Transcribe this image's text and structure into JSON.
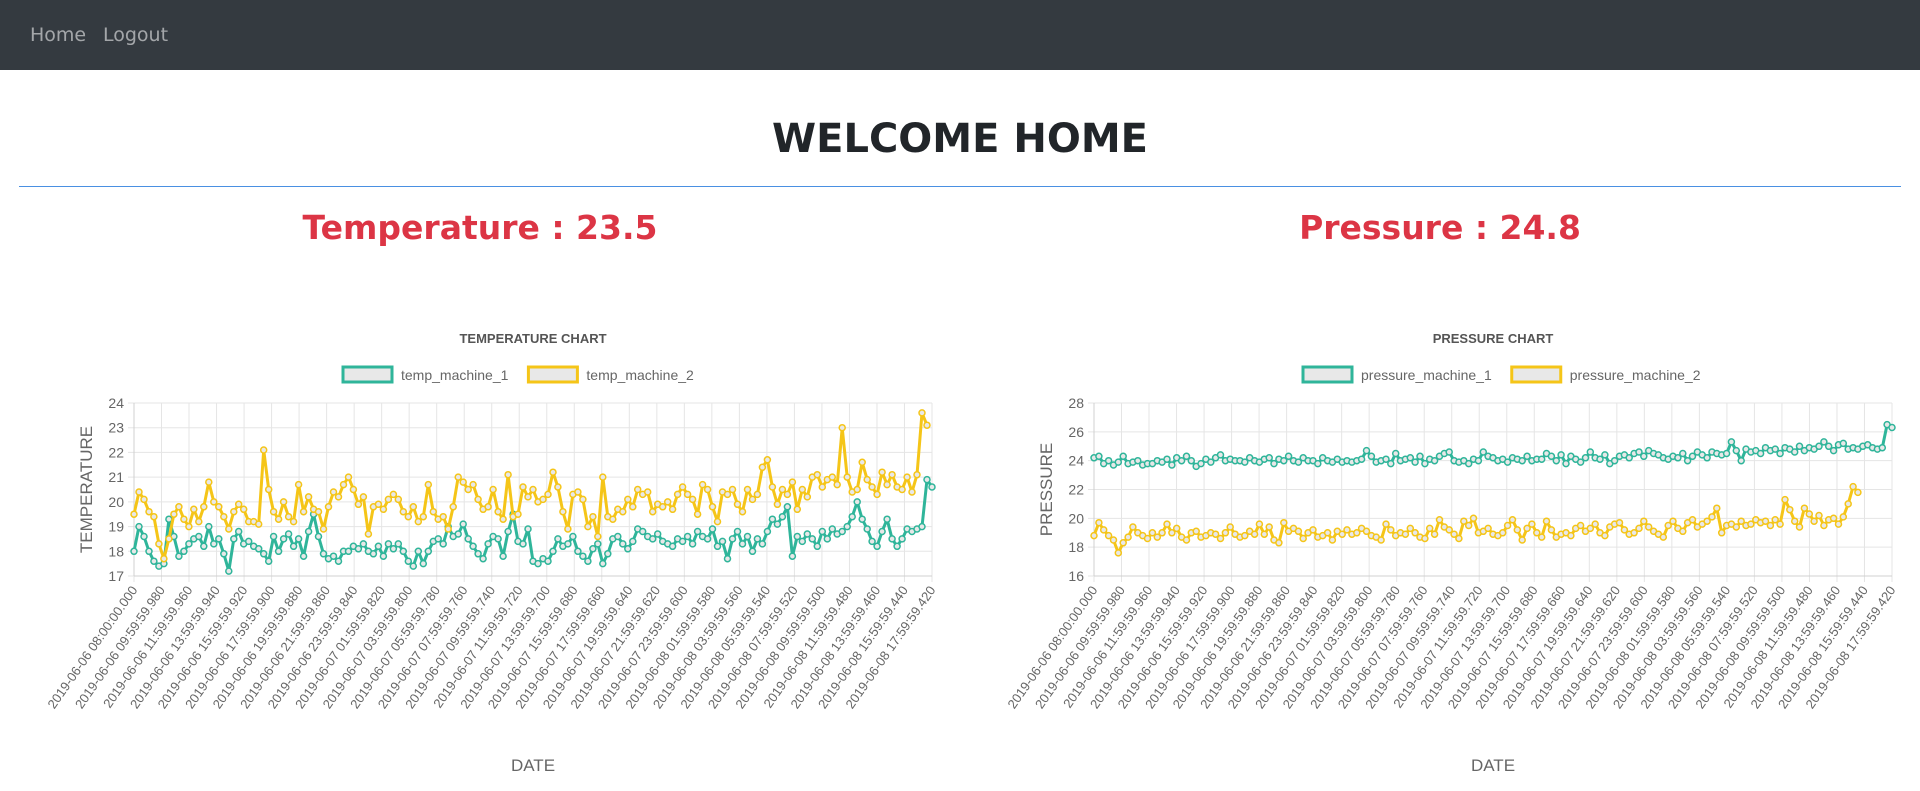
{
  "nav": {
    "home_label": "Home",
    "logout_label": "Logout"
  },
  "page": {
    "title": "WELCOME HOME",
    "temperature_reading": "Temperature : 23.5",
    "pressure_reading": "Pressure : 24.8"
  },
  "colors": {
    "navbar": "#343a40",
    "accent_red": "#dc3545",
    "divider_blue": "#4a90e2",
    "series_teal": "#2fb59a",
    "series_yellow": "#f5c518"
  },
  "chart_data": [
    {
      "type": "line",
      "title": "TEMPERATURE CHART",
      "xlabel": "DATE",
      "ylabel": "TEMPERATURE",
      "ylim": [
        17,
        24
      ],
      "yticks": [
        17,
        18,
        19,
        20,
        21,
        22,
        23,
        24
      ],
      "grid": true,
      "legend_position": "top",
      "tick_labels": [
        "2019-06-06 08:00:00.000",
        "2019-06-06 09:59:59.980",
        "2019-06-06 11:59:59.960",
        "2019-06-06 13:59:59.940",
        "2019-06-06 15:59:59.920",
        "2019-06-06 17:59:59.900",
        "2019-06-06 19:59:59.880",
        "2019-06-06 21:59:59.860",
        "2019-06-06 23:59:59.840",
        "2019-06-07 01:59:59.820",
        "2019-06-07 03:59:59.800",
        "2019-06-07 05:59:59.780",
        "2019-06-07 07:59:59.760",
        "2019-06-07 09:59:59.740",
        "2019-06-07 11:59:59.720",
        "2019-06-07 13:59:59.700",
        "2019-06-07 15:59:59.680",
        "2019-06-07 17:59:59.660",
        "2019-06-07 19:59:59.640",
        "2019-06-07 21:59:59.620",
        "2019-06-07 23:59:59.600",
        "2019-06-08 01:59:59.580",
        "2019-06-08 03:59:59.560",
        "2019-06-08 05:59:59.540",
        "2019-06-08 07:59:59.520",
        "2019-06-08 09:59:59.500",
        "2019-06-08 11:59:59.480",
        "2019-06-08 13:59:59.460",
        "2019-06-08 15:59:59.440",
        "2019-06-08 17:59:59.420"
      ],
      "series": [
        {
          "name": "temp_machine_1",
          "color": "#2fb59a",
          "values": [
            18.0,
            19.0,
            18.6,
            18.0,
            17.6,
            17.4,
            17.5,
            19.3,
            18.6,
            17.8,
            18.0,
            18.3,
            18.5,
            18.6,
            18.2,
            19.0,
            18.3,
            18.5,
            17.9,
            17.2,
            18.5,
            18.8,
            18.3,
            18.4,
            18.2,
            18.1,
            17.9,
            17.6,
            18.6,
            18.0,
            18.5,
            18.7,
            18.2,
            18.5,
            17.8,
            18.8,
            19.5,
            18.6,
            17.9,
            17.7,
            17.8,
            17.6,
            18.0,
            18.0,
            18.2,
            18.1,
            18.3,
            18.0,
            17.9,
            18.2,
            17.8,
            18.3,
            18.1,
            18.3,
            18.0,
            17.6,
            17.4,
            18.0,
            17.5,
            18.0,
            18.4,
            18.5,
            18.3,
            19.0,
            18.6,
            18.7,
            19.1,
            18.5,
            18.2,
            17.9,
            17.7,
            18.3,
            18.6,
            18.5,
            17.8,
            18.8,
            19.5,
            18.4,
            18.3,
            18.9,
            17.6,
            17.5,
            17.7,
            17.6,
            18.0,
            18.5,
            18.2,
            18.3,
            18.6,
            18.0,
            17.8,
            17.6,
            18.1,
            18.3,
            17.5,
            17.9,
            18.5,
            18.6,
            18.3,
            18.1,
            18.4,
            18.9,
            18.8,
            18.6,
            18.5,
            18.7,
            18.4,
            18.3,
            18.2,
            18.5,
            18.4,
            18.6,
            18.3,
            18.8,
            18.6,
            18.5,
            18.9,
            18.2,
            18.4,
            17.7,
            18.5,
            18.8,
            18.3,
            18.6,
            18.0,
            18.5,
            18.3,
            18.8,
            19.3,
            19.1,
            19.4,
            19.8,
            17.8,
            18.6,
            18.4,
            18.7,
            18.5,
            18.2,
            18.8,
            18.5,
            18.9,
            18.7,
            18.8,
            19.0,
            19.4,
            20.0,
            19.3,
            18.9,
            18.4,
            18.2,
            18.8,
            19.3,
            18.5,
            18.2,
            18.5,
            18.9,
            18.8,
            18.9,
            19.0,
            20.9,
            20.6
          ]
        },
        {
          "name": "temp_machine_2",
          "color": "#f5c518",
          "values": [
            19.5,
            20.4,
            20.1,
            19.6,
            19.4,
            18.3,
            17.7,
            18.5,
            19.5,
            19.8,
            19.3,
            19.0,
            19.7,
            19.2,
            19.8,
            20.8,
            20.0,
            19.8,
            19.4,
            18.9,
            19.6,
            19.9,
            19.7,
            19.2,
            19.2,
            19.1,
            22.1,
            20.5,
            19.6,
            19.3,
            20.0,
            19.4,
            19.2,
            20.7,
            19.6,
            20.2,
            19.7,
            19.6,
            18.9,
            19.8,
            20.4,
            20.2,
            20.7,
            21.0,
            20.5,
            19.9,
            20.2,
            18.7,
            19.8,
            19.9,
            19.7,
            20.1,
            20.3,
            20.1,
            19.6,
            19.4,
            19.8,
            19.2,
            19.4,
            20.7,
            19.6,
            19.3,
            19.4,
            18.9,
            19.8,
            21.0,
            20.8,
            20.5,
            20.7,
            20.1,
            19.7,
            19.8,
            20.5,
            19.6,
            19.3,
            21.1,
            19.4,
            19.5,
            20.6,
            20.2,
            20.5,
            20.0,
            20.1,
            20.3,
            21.2,
            20.6,
            19.6,
            18.9,
            20.3,
            20.4,
            20.1,
            19.0,
            19.4,
            18.6,
            21.0,
            19.4,
            19.3,
            19.7,
            19.6,
            20.1,
            19.8,
            20.5,
            20.3,
            20.4,
            19.6,
            19.9,
            19.8,
            20.0,
            19.7,
            20.3,
            20.6,
            20.3,
            20.1,
            19.5,
            20.7,
            20.5,
            19.8,
            19.2,
            20.4,
            20.3,
            20.5,
            19.9,
            19.6,
            20.5,
            20.1,
            20.3,
            21.4,
            21.7,
            20.6,
            19.9,
            20.5,
            20.3,
            20.8,
            19.7,
            20.5,
            20.2,
            21.0,
            21.1,
            20.6,
            20.9,
            21.0,
            20.7,
            23.0,
            21.0,
            20.4,
            20.5,
            21.6,
            20.9,
            20.6,
            20.3,
            21.2,
            20.7,
            21.1,
            20.6,
            20.5,
            21.0,
            20.4,
            21.1,
            23.6,
            23.1
          ]
        }
      ]
    },
    {
      "type": "line",
      "title": "PRESSURE CHART",
      "xlabel": "DATE",
      "ylabel": "PRESSURE",
      "ylim": [
        16,
        28
      ],
      "yticks": [
        16,
        18,
        20,
        22,
        24,
        26,
        28
      ],
      "grid": true,
      "legend_position": "top",
      "tick_labels": [
        "2019-06-06 08:00:00.000",
        "2019-06-06 09:59:59.980",
        "2019-06-06 11:59:59.960",
        "2019-06-06 13:59:59.940",
        "2019-06-06 15:59:59.920",
        "2019-06-06 17:59:59.900",
        "2019-06-06 19:59:59.880",
        "2019-06-06 21:59:59.860",
        "2019-06-06 23:59:59.840",
        "2019-06-07 01:59:59.820",
        "2019-06-07 03:59:59.800",
        "2019-06-07 05:59:59.780",
        "2019-06-07 07:59:59.760",
        "2019-06-07 09:59:59.740",
        "2019-06-07 11:59:59.720",
        "2019-06-07 13:59:59.700",
        "2019-06-07 15:59:59.680",
        "2019-06-07 17:59:59.660",
        "2019-06-07 19:59:59.640",
        "2019-06-07 21:59:59.620",
        "2019-06-07 23:59:59.600",
        "2019-06-08 01:59:59.580",
        "2019-06-08 03:59:59.560",
        "2019-06-08 05:59:59.540",
        "2019-06-08 07:59:59.520",
        "2019-06-08 09:59:59.500",
        "2019-06-08 11:59:59.480",
        "2019-06-08 13:59:59.460",
        "2019-06-08 15:59:59.440",
        "2019-06-08 17:59:59.420"
      ],
      "series": [
        {
          "name": "pressure_machine_1",
          "color": "#2fb59a",
          "values": [
            24.2,
            24.3,
            23.8,
            24.0,
            23.7,
            23.9,
            24.3,
            23.8,
            23.9,
            24.0,
            23.7,
            23.8,
            23.8,
            24.0,
            23.9,
            24.1,
            23.7,
            24.2,
            24.0,
            24.3,
            24.0,
            23.6,
            23.8,
            24.1,
            23.9,
            24.2,
            24.4,
            24.0,
            24.1,
            24.0,
            24.0,
            23.9,
            24.2,
            24.0,
            23.9,
            24.1,
            24.2,
            23.8,
            24.1,
            24.0,
            24.3,
            24.0,
            23.9,
            24.2,
            24.0,
            24.0,
            23.8,
            24.2,
            24.0,
            23.9,
            24.1,
            23.9,
            24.0,
            23.9,
            24.0,
            24.1,
            24.7,
            24.3,
            23.9,
            24.0,
            24.1,
            23.8,
            24.5,
            24.0,
            24.1,
            24.2,
            23.9,
            24.3,
            23.8,
            24.1,
            24.0,
            24.3,
            24.5,
            24.6,
            24.0,
            23.9,
            24.0,
            23.8,
            24.1,
            24.0,
            24.6,
            24.3,
            24.2,
            24.0,
            24.1,
            23.9,
            24.2,
            24.1,
            24.0,
            24.3,
            24.0,
            24.1,
            24.1,
            24.5,
            24.3,
            24.0,
            24.4,
            23.8,
            24.3,
            24.1,
            23.9,
            24.2,
            24.6,
            24.2,
            24.1,
            24.4,
            23.8,
            24.0,
            24.3,
            24.4,
            24.2,
            24.5,
            24.6,
            24.3,
            24.7,
            24.5,
            24.4,
            24.2,
            24.1,
            24.3,
            24.2,
            24.5,
            24.0,
            24.3,
            24.6,
            24.4,
            24.2,
            24.6,
            24.5,
            24.4,
            24.5,
            25.3,
            24.7,
            24.0,
            24.8,
            24.6,
            24.7,
            24.5,
            24.9,
            24.7,
            24.8,
            24.5,
            24.9,
            24.8,
            24.6,
            25.0,
            24.7,
            24.9,
            24.8,
            25.0,
            25.3,
            25.0,
            24.7,
            25.1,
            25.2,
            24.8,
            24.9,
            24.8,
            25.0,
            25.1,
            24.9,
            24.8,
            24.9,
            26.5,
            26.3
          ]
        },
        {
          "name": "pressure_machine_2",
          "color": "#f5c518",
          "values": [
            18.8,
            19.7,
            19.2,
            18.8,
            18.5,
            17.6,
            18.3,
            18.7,
            19.4,
            19.0,
            18.8,
            18.6,
            19.0,
            18.7,
            19.0,
            19.6,
            19.0,
            19.3,
            18.7,
            18.5,
            19.0,
            19.1,
            18.7,
            18.8,
            19.0,
            18.9,
            18.6,
            19.0,
            19.4,
            18.9,
            18.7,
            18.8,
            19.1,
            18.9,
            19.6,
            18.9,
            19.4,
            18.5,
            18.3,
            19.7,
            19.1,
            19.3,
            19.1,
            18.6,
            19.0,
            19.2,
            18.7,
            18.8,
            19.0,
            18.5,
            19.1,
            18.9,
            19.2,
            18.9,
            19.0,
            19.3,
            19.1,
            18.8,
            18.7,
            18.5,
            19.6,
            19.2,
            18.8,
            19.0,
            18.9,
            19.3,
            19.0,
            18.7,
            18.6,
            19.3,
            18.9,
            19.9,
            19.4,
            19.2,
            18.9,
            18.6,
            19.8,
            19.5,
            20.0,
            19.0,
            19.1,
            19.3,
            18.9,
            18.8,
            19.0,
            19.5,
            19.9,
            19.2,
            18.5,
            19.3,
            19.6,
            19.0,
            18.7,
            19.8,
            19.2,
            18.7,
            18.9,
            19.0,
            18.8,
            19.3,
            19.5,
            19.1,
            19.3,
            19.6,
            19.0,
            18.8,
            19.4,
            19.6,
            19.7,
            19.2,
            18.9,
            19.0,
            19.3,
            19.8,
            19.4,
            19.1,
            18.9,
            18.7,
            19.5,
            19.8,
            19.3,
            19.1,
            19.7,
            19.9,
            19.4,
            19.6,
            19.8,
            20.1,
            20.7,
            19.0,
            19.5,
            19.6,
            19.4,
            19.8,
            19.5,
            19.6,
            19.9,
            19.7,
            19.8,
            19.5,
            19.9,
            19.6,
            21.3,
            20.6,
            19.8,
            19.4,
            20.7,
            20.3,
            19.8,
            20.2,
            19.5,
            19.9,
            20.0,
            19.6,
            20.1,
            21.0,
            22.2,
            21.8
          ]
        }
      ]
    }
  ]
}
